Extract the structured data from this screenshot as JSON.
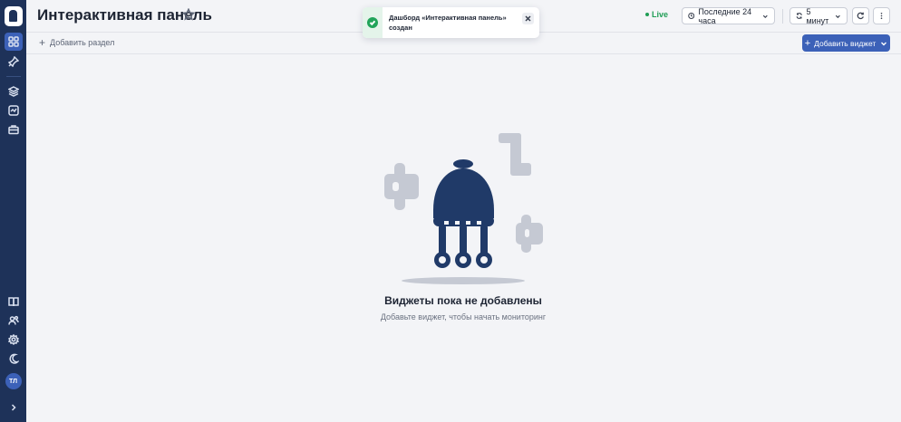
{
  "sidebar": {
    "avatar_initials": "ТЛ",
    "icons": [
      "dashboard-grid-icon",
      "pin-icon",
      "layers-icon",
      "activity-icon",
      "briefcase-icon",
      "book-icon",
      "users-icon",
      "gear-icon",
      "moon-icon",
      "chevron-right-icon"
    ]
  },
  "header": {
    "title": "Интерактивная панель",
    "live_label": "Live",
    "time_range": "Последние 24 часа",
    "refresh_interval": "5 минут"
  },
  "toast": {
    "message": "Дашборд «Интерактивная панель» создан",
    "status": "success"
  },
  "toolbar": {
    "add_section_label": "Добавить раздел",
    "add_widget_label": "Добавить виджет"
  },
  "empty_state": {
    "title": "Виджеты пока не добавлены",
    "subtitle": "Добавьте виджет, чтобы начать мониторинг"
  },
  "colors": {
    "sidebar_bg": "#1e3259",
    "accent": "#3c61b8",
    "live_green": "#1f9d55",
    "illustration_dark": "#203a68",
    "illustration_light": "#c5c9d3"
  }
}
